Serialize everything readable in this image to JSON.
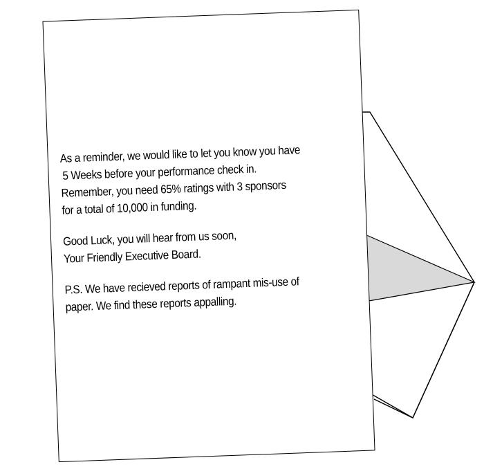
{
  "letter": {
    "paragraphs": [
      {
        "lines": [
          "As a reminder, we would like to let you know you have",
          "5 Weeks before your performance check in.",
          "Remember, you need 65% ratings with 3 sponsors",
          "for a total of 10,000 in funding."
        ]
      },
      {
        "lines": [
          "Good Luck, you will hear from us soon,",
          "Your Friendly Executive Board."
        ]
      },
      {
        "lines": [
          "P.S. We have recieved reports of rampant mis-use of",
          "paper. We find these reports appalling."
        ]
      }
    ]
  },
  "colors": {
    "paper": "#ffffff",
    "ink": "#000000",
    "envelope_flap_shade": "#d9d9d9"
  },
  "icons": {
    "envelope": "envelope-icon"
  }
}
